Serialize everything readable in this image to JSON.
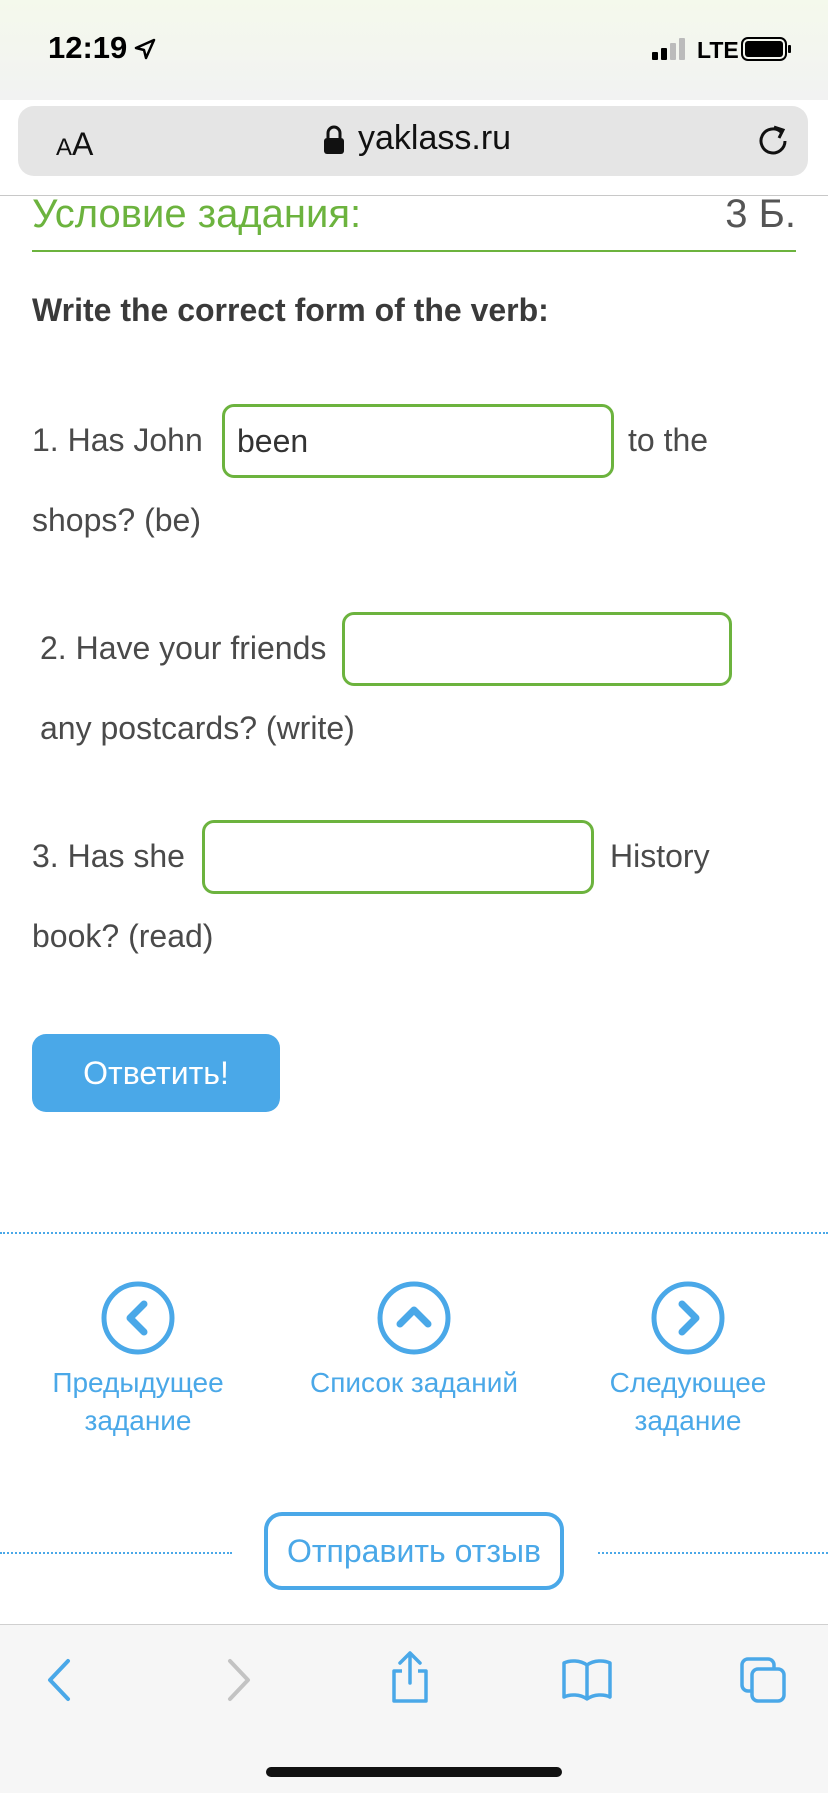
{
  "status_bar": {
    "time": "12:19",
    "network": "LTE"
  },
  "browser": {
    "text_size_small": "A",
    "text_size_large": "A",
    "domain": "yaklass.ru"
  },
  "task": {
    "header_title": "Условие задания:",
    "points": "3 Б.",
    "instruction": "Write the correct form of the verb:",
    "q1": {
      "before": "1. Has John",
      "value": "been",
      "after": "to the",
      "cont": "shops? (be)"
    },
    "q2": {
      "before": "2. Have your friends",
      "value": "",
      "cont": "any postcards? (write)"
    },
    "q3": {
      "before": "3. Has she",
      "value": "",
      "after": "History",
      "cont": "book? (read)"
    },
    "submit_label": "Ответить!"
  },
  "nav": {
    "prev_line1": "Предыдущее",
    "prev_line2": "задание",
    "list": "Список заданий",
    "next_line1": "Следующее",
    "next_line2": "задание"
  },
  "feedback_label": "Отправить отзыв",
  "colors": {
    "accent_green": "#6cb33e",
    "accent_blue": "#4aa8e8"
  }
}
